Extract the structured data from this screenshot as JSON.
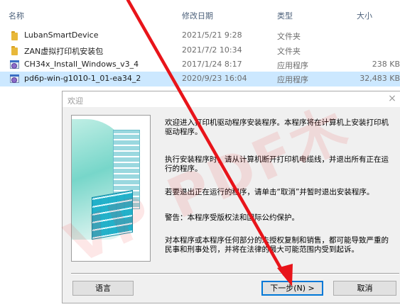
{
  "columns": {
    "name": "名称",
    "date": "修改日期",
    "type": "类型",
    "size": "大小"
  },
  "files": [
    {
      "icon": "folder-icon",
      "name": "LubanSmartDevice",
      "date": "2021/5/21 9:28",
      "type": "文件夹",
      "size": ""
    },
    {
      "icon": "folder-icon",
      "name": "ZAN虚拟打印机安装包",
      "date": "2021/7/2 10:34",
      "type": "文件夹",
      "size": ""
    },
    {
      "icon": "exe-icon",
      "name": "CH34x_Install_Windows_v3_4",
      "date": "2017/1/24 8:17",
      "type": "应用程序",
      "size": "238 KB"
    },
    {
      "icon": "exe-icon",
      "name": "pd6p-win-g1010-1_01-ea34_2",
      "date": "2020/9/23 16:04",
      "type": "应用程序",
      "size": "32,483 KB",
      "selected": true
    }
  ],
  "dialog": {
    "title": "欢迎",
    "close": "×",
    "paragraphs": [
      "欢迎进入打印机驱动程序安装程序。本程序将在计算机上安装打印机驱动程序。",
      "执行安装程序时，请从计算机断开打印机电缆线，并退出所有正在运行的程序。",
      "若要退出正在运行的程序，请单击“取消”并暂时退出安装程序。",
      "警告：本程序受版权法和国际公约保护。",
      "对本程序或本程序任何部分的未授权复制和销售，都可能导致严重的民事和刑事处罚，并将在法律的最大可能范围内受到起诉。"
    ],
    "buttons": {
      "language": "语言",
      "next": "下一步(N) >",
      "cancel": "取消"
    }
  },
  "watermark": "VP PDF木",
  "colors": {
    "selection": "#cce8ff",
    "arrow": "#e8141a",
    "accent": "#0078d7"
  }
}
